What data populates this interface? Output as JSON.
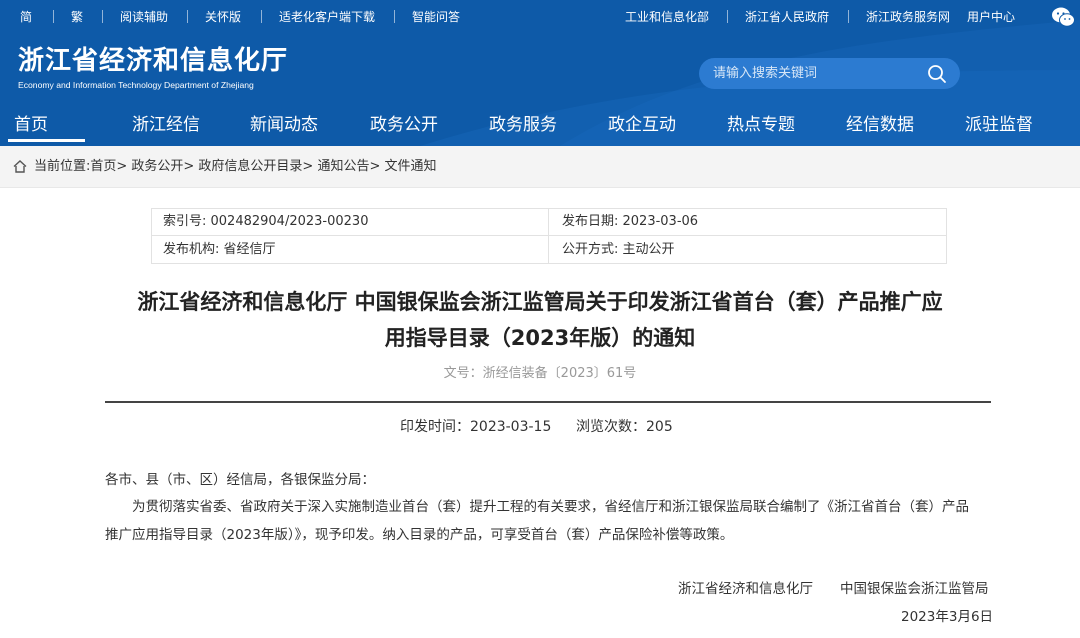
{
  "topbar": {
    "left_links": [
      "简",
      "繁",
      "阅读辅助",
      "关怀版",
      "适老化客户端下载",
      "智能问答"
    ],
    "right_links": [
      "工业和信息化部",
      "浙江省人民政府",
      "浙江政务服务网",
      "用户中心"
    ]
  },
  "logo": {
    "title": "浙江省经济和信息化厅",
    "subtitle": "Economy and Information Technology Department of Zhejiang"
  },
  "search": {
    "placeholder": "请输入搜索关键词"
  },
  "nav": {
    "items": [
      "首页",
      "浙江经信",
      "新闻动态",
      "政务公开",
      "政务服务",
      "政企互动",
      "热点专题",
      "经信数据",
      "派驻监督"
    ],
    "active": "首页"
  },
  "breadcrumb": {
    "text": "当前位置:首页> 政务公开> 政府信息公开目录> 通知公告> 文件通知"
  },
  "info": {
    "index_no": "索引号: 002482904/2023-00230",
    "publish_date": "发布日期: 2023-03-06",
    "publisher": "发布机构: 省经信厅",
    "disclosure": "公开方式: 主动公开"
  },
  "article": {
    "title_line1": "浙江省经济和信息化厅 中国银保监会浙江监管局关于印发浙江省首台（套）产品推广应",
    "title_line2": "用指导目录（2023年版）的通知",
    "doc_no": "文号：浙经信装备〔2023〕61号",
    "issue_time": "印发时间：2023-03-15",
    "views": "浏览次数：205",
    "salutation": "各市、县（市、区）经信局，各银保监分局：",
    "body_line1": "为贯彻落实省委、省政府关于深入实施制造业首台（套）提升工程的有关要求，省经信厅和浙江银保监局联合编制了《浙江省首台（套）产品",
    "body_line2": "推广应用指导目录（2023年版）》，现予印发。纳入目录的产品，可享受首台（套）产品保险补偿等政策。",
    "signer1": "浙江省经济和信息化厅",
    "signer2": "中国银保监会浙江监管局",
    "sign_date": "2023年3月6日"
  },
  "colors": {
    "header_blue": "#0e5aa8",
    "search_bg": "#2c7bd1",
    "breadcrumb_bg": "#f4f4f4"
  }
}
